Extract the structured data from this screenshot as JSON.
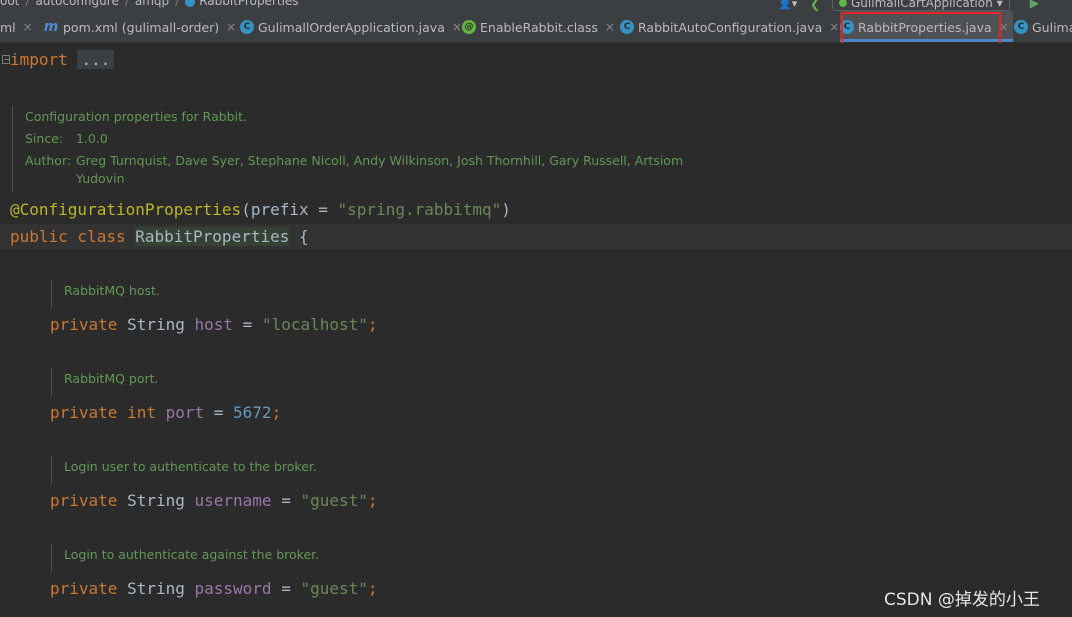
{
  "breadcrumb": {
    "items": [
      "oot",
      "autoconfigure",
      "amqp",
      "RabbitProperties"
    ]
  },
  "toolbar": {
    "run_config": "GulimallCartApplication",
    "run_config_arrow": "▾"
  },
  "tabs": [
    {
      "label": "ml",
      "icon": "none",
      "closable": true
    },
    {
      "label": "pom.xml (gulimall-order)",
      "icon": "maven-icon",
      "closable": true
    },
    {
      "label": "GulimallOrderApplication.java",
      "icon": "class-icon",
      "closable": true
    },
    {
      "label": "EnableRabbit.class",
      "icon": "annotation-icon",
      "closable": true
    },
    {
      "label": "RabbitAutoConfiguration.java",
      "icon": "class-icon",
      "closable": true
    },
    {
      "label": "RabbitProperties.java",
      "icon": "class-icon",
      "closable": true,
      "active": true
    },
    {
      "label": "Gulima",
      "icon": "class-icon",
      "closable": false
    }
  ],
  "code": {
    "import_kw": "import",
    "import_folded": "...",
    "class_doc": {
      "summary": "Configuration properties for Rabbit.",
      "since_label": "Since:",
      "since_value": "1.0.0",
      "author_label": "Author:",
      "author_value_1": "Greg Turnquist, Dave Syer, Stephane Nicoll, Andy Wilkinson, Josh Thornhill, Gary Russell, Artsiom",
      "author_value_2": "Yudovin"
    },
    "annotation": "@ConfigurationProperties",
    "annotation_open": "(",
    "annotation_param": "prefix",
    "annotation_eq": " = ",
    "annotation_value": "\"spring.rabbitmq\"",
    "annotation_close": ")",
    "class_decl_kw": "public class ",
    "class_name": "RabbitProperties",
    "class_brace": " {",
    "fields": [
      {
        "doc": "RabbitMQ host.",
        "kw": "private ",
        "type": "String ",
        "name": "host",
        "eq": " = ",
        "value": "\"localhost\"",
        "value_kind": "str",
        "semi": ";"
      },
      {
        "doc": "RabbitMQ port.",
        "kw": "private ",
        "type": "int ",
        "name": "port",
        "eq": " = ",
        "value": "5672",
        "value_kind": "num",
        "semi": ";"
      },
      {
        "doc": "Login user to authenticate to the broker.",
        "kw": "private ",
        "type": "String ",
        "name": "username",
        "eq": " = ",
        "value": "\"guest\"",
        "value_kind": "str",
        "semi": ";"
      },
      {
        "doc": "Login to authenticate against the broker.",
        "kw": "private ",
        "type": "String ",
        "name": "password",
        "eq": " = ",
        "value": "\"guest\"",
        "value_kind": "str",
        "semi": ";"
      }
    ]
  },
  "watermark": "CSDN @掉发的小王",
  "colors": {
    "keyword": "#cc7832",
    "annotation": "#bbb529",
    "string": "#6a8759",
    "number": "#6897bb",
    "field": "#9876aa",
    "doc": "#629755",
    "highlight_box": "#e8262a"
  }
}
